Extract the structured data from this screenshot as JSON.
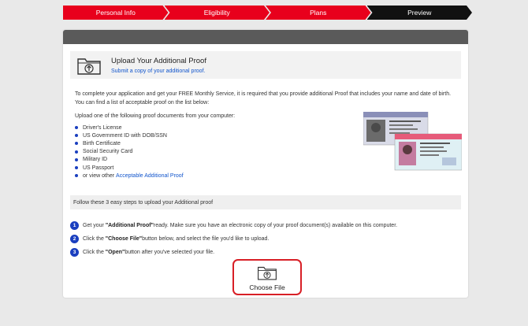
{
  "stepper": {
    "steps": [
      {
        "label": "Personal Info",
        "active": false
      },
      {
        "label": "Eligibility",
        "active": false
      },
      {
        "label": "Plans",
        "active": false
      },
      {
        "label": "Preview",
        "active": true
      }
    ],
    "color_inactive": "#e8001c",
    "color_active": "#111111"
  },
  "upload": {
    "title": "Upload Your Additional Proof",
    "subtitle": "Submit a copy of your additional proof.",
    "icon": "folder-upload-icon"
  },
  "intro": {
    "text": "To complete your application and get your FREE Monthly Service, it is required that you provide additional Proof that includes your name and date of birth. You can find a list of acceptable proof on the list below:"
  },
  "documents": {
    "lead": "Upload one of the following proof documents from your computer:",
    "items": [
      "Driver's License",
      "US Government ID with DOB/SSN",
      "Birth Certificate",
      "Social Security Card",
      "Military ID",
      "US Passport"
    ],
    "view_other_prefix": "or view other ",
    "view_other_link": "Acceptable Additional Proof"
  },
  "steps_section": {
    "heading": "Follow these 3 easy steps to upload your Additional proof",
    "steps": [
      {
        "num": "1",
        "pre": "Get your ",
        "bold": "\"Additional Proof\"",
        "post": " ready. Make sure you have an electronic copy of your proof document(s) available on this computer."
      },
      {
        "num": "2",
        "pre": "Click the ",
        "bold": "\"Choose File\"",
        "post": " button below, and select the file you'd like to upload."
      },
      {
        "num": "3",
        "pre": "Click the ",
        "bold": "\"Open\"",
        "post": " button after you've selected your file."
      }
    ]
  },
  "choose_file": {
    "label": "Choose File",
    "border_color": "#d81f26"
  },
  "accent_link_color": "#1155cc",
  "bullet_color": "#1a3fbf"
}
